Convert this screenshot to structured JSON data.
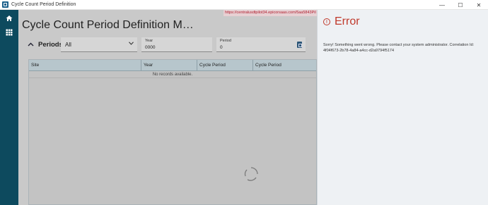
{
  "window": {
    "title": "Cycle Count Period Definition",
    "controls": {
      "minimize": "—",
      "maximize": "☐",
      "close": "✕"
    }
  },
  "nav": {
    "icons": [
      "home-icon",
      "grid-icon"
    ]
  },
  "main": {
    "url": "https://centralusdtpilot34.epicorsaas.com/5aa5843Pil",
    "page_title": "Cycle Count Period Definition M…",
    "periods": {
      "label": "Periods",
      "select_value": "All",
      "year_label": "Year",
      "year_value": "0000",
      "period_label": "Period",
      "period_value": "0"
    },
    "grid": {
      "columns": [
        "Site",
        "Year",
        "Cycle Period",
        "Cycle Period"
      ],
      "empty_message": "No records available."
    }
  },
  "error": {
    "title": "Error",
    "message": "Sorry! Something went wrong. Please contact your system administrator. Correlation Id: 4f04f673-2b78-4a84-a4cc-d2a9794f5174"
  },
  "colors": {
    "nav_bg": "#0d4a5e",
    "error_red": "#c0392b",
    "overlay_gray": "#c9c9c9"
  }
}
